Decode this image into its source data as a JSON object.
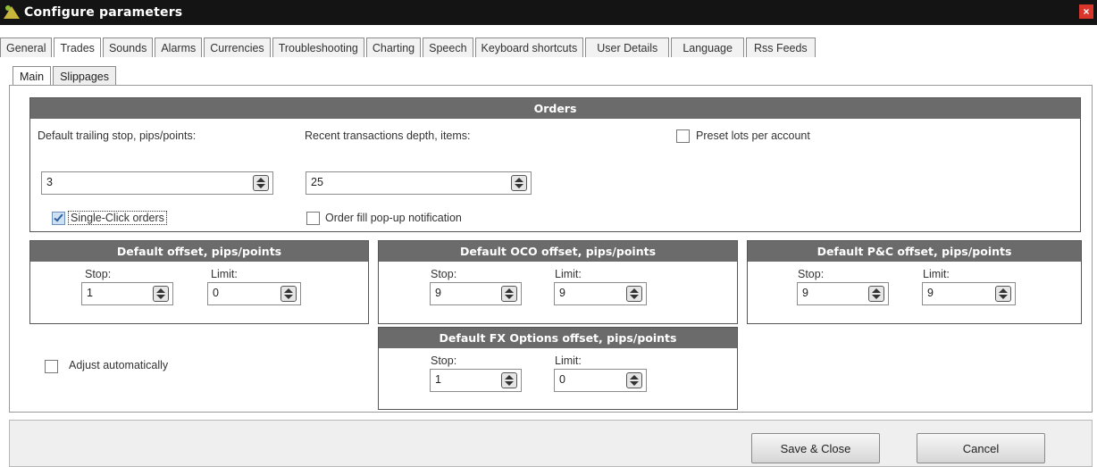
{
  "window": {
    "title": "Configure parameters",
    "close_glyph": "×"
  },
  "tabs": [
    {
      "label": "General"
    },
    {
      "label": "Trades"
    },
    {
      "label": "Sounds"
    },
    {
      "label": "Alarms"
    },
    {
      "label": "Currencies"
    },
    {
      "label": "Troubleshooting"
    },
    {
      "label": "Charting"
    },
    {
      "label": "Speech"
    },
    {
      "label": "Keyboard shortcuts"
    },
    {
      "label": "User Details"
    },
    {
      "label": "Language"
    },
    {
      "label": "Rss Feeds"
    }
  ],
  "active_tab": "Trades",
  "subtabs": [
    {
      "label": "Main"
    },
    {
      "label": "Slippages"
    }
  ],
  "orders": {
    "title": "Orders",
    "trailing_label": "Default trailing stop, pips/points:",
    "trailing_value": "3",
    "depth_label": "Recent transactions depth, items:",
    "depth_value": "25",
    "preset_label": "Preset lots per account",
    "preset_checked": false,
    "single_click_label": "Single-Click orders",
    "single_click_checked": true,
    "popup_label": "Order fill pop-up notification",
    "popup_checked": false
  },
  "default_offset": {
    "title": "Default offset, pips/points",
    "stop_label": "Stop:",
    "stop_value": "1",
    "limit_label": "Limit:",
    "limit_value": "0"
  },
  "oco_offset": {
    "title": "Default OCO offset, pips/points",
    "stop_label": "Stop:",
    "stop_value": "9",
    "limit_label": "Limit:",
    "limit_value": "9"
  },
  "pc_offset": {
    "title": "Default P&C offset, pips/points",
    "stop_label": "Stop:",
    "stop_value": "9",
    "limit_label": "Limit:",
    "limit_value": "9"
  },
  "fx_offset": {
    "title": "Default FX Options offset, pips/points",
    "stop_label": "Stop:",
    "stop_value": "1",
    "limit_label": "Limit:",
    "limit_value": "0"
  },
  "adjust": {
    "label": "Adjust automatically",
    "checked": false
  },
  "footer": {
    "save_label": "Save & Close",
    "cancel_label": "Cancel"
  },
  "colors": {
    "titlebar": "#141414",
    "panel_header": "#6b6b6b",
    "close": "#d9362b"
  }
}
